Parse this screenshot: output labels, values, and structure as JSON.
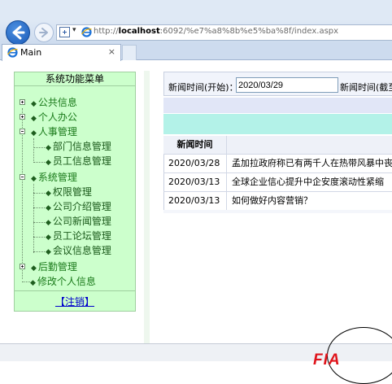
{
  "browser": {
    "url_prefix": "http://",
    "url_host": "localhost",
    "url_rest": ":6092/%e7%a8%8b%e5%ba%8f/index.aspx",
    "tab_title": "Main",
    "tab_close": "×"
  },
  "sidebar": {
    "title": "系统功能菜单",
    "items": [
      {
        "label": "公共信息"
      },
      {
        "label": "个人办公"
      },
      {
        "label": "人事管理"
      },
      {
        "label": "部门信息管理"
      },
      {
        "label": "员工信息管理"
      },
      {
        "label": "系统管理"
      },
      {
        "label": "权限管理"
      },
      {
        "label": "公司介绍管理"
      },
      {
        "label": "公司新闻管理"
      },
      {
        "label": "员工论坛管理"
      },
      {
        "label": "会议信息管理"
      },
      {
        "label": "后勤管理"
      },
      {
        "label": "修改个人信息"
      }
    ],
    "logout": "【注销】"
  },
  "filter": {
    "start_label": "新闻时间(开始)：",
    "start_value": "2020/03/29",
    "end_label": "新闻时间(截至"
  },
  "grid": {
    "headers": [
      "新闻时间",
      ""
    ],
    "rows": [
      [
        "2020/03/28",
        "孟加拉政府称已有两千人在热带风暴中丧生"
      ],
      [
        "2020/03/13",
        "全球企业信心提升中企安度滚动性紧缩"
      ],
      [
        "2020/03/13",
        "如何做好内容营销？"
      ]
    ]
  },
  "watermark": {
    "logo": "FIA"
  },
  "colors": {
    "sidebar_bg": "#ccffcc",
    "band_a": "#e1e6f7",
    "band_b": "#b3f2e8",
    "link": "#0000cc"
  }
}
